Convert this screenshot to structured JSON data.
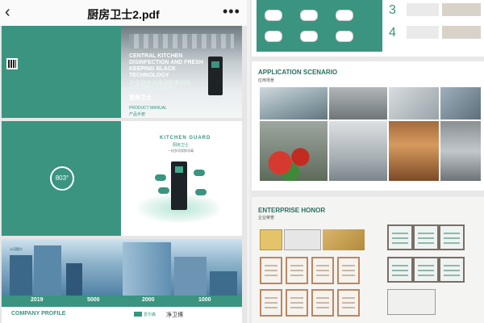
{
  "topbar": {
    "back_icon": "chevron-left-icon",
    "title": "厨房卫士2.pdf",
    "more_icon": "more-dots-icon"
  },
  "page1": {
    "headline": "CENTRAL KITCHEN DISINFECTION AND FRESH KEEPING BLACK TECHNOLOGY",
    "headline_cn": "中央厨房消毒保鲜黑科技",
    "brand": "KITCHEN GUARD",
    "brand_cn": "厨房卫士",
    "product": "PRODUCT MANUAL",
    "product_cn": "产品手册"
  },
  "page2": {
    "badge": "803",
    "brand": "KITCHEN GUARD",
    "brand_cn": "厨房卫士",
    "subtitle": "一机多用保鲜消毒"
  },
  "page3": {
    "years": [
      "2019",
      "5000",
      "2000",
      "1000"
    ],
    "section": "COMPANY PROFILE",
    "logo1": "爱尔森",
    "logo2": "净卫博",
    "small_caption": "公司简介"
  },
  "steps": [
    "3",
    "4"
  ],
  "application": {
    "title": "APPLICATION SCENARIO",
    "title_cn": "应用场景"
  },
  "honor": {
    "title": "ENTERPRISE HONOR",
    "title_cn": "企业荣誉"
  },
  "colors": {
    "teal": "#3a9480",
    "dark": "#1d2a2e",
    "cert_frame": "#c0855e"
  }
}
